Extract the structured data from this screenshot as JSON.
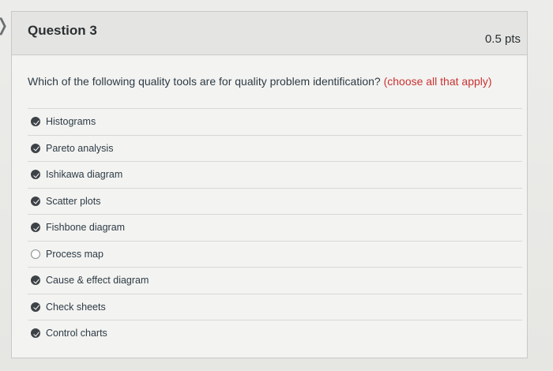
{
  "question": {
    "title": "Question 3",
    "points": "0.5 pts",
    "text": "Which of the following quality tools are for quality problem identification?",
    "hint": "(choose all that apply)"
  },
  "answers": [
    {
      "label": "Histograms",
      "checked": true
    },
    {
      "label": "Pareto analysis",
      "checked": true
    },
    {
      "label": "Ishikawa diagram",
      "checked": true
    },
    {
      "label": "Scatter plots",
      "checked": true
    },
    {
      "label": "Fishbone diagram",
      "checked": true
    },
    {
      "label": "Process map",
      "checked": false
    },
    {
      "label": "Cause & effect diagram",
      "checked": true
    },
    {
      "label": "Check sheets",
      "checked": true
    },
    {
      "label": "Control charts",
      "checked": true
    }
  ],
  "icons": {
    "previous": "chevron-left-icon",
    "checked": "checkmark-icon"
  },
  "colors": {
    "hint": "#c93232",
    "checked_fill": "#3d4247"
  }
}
